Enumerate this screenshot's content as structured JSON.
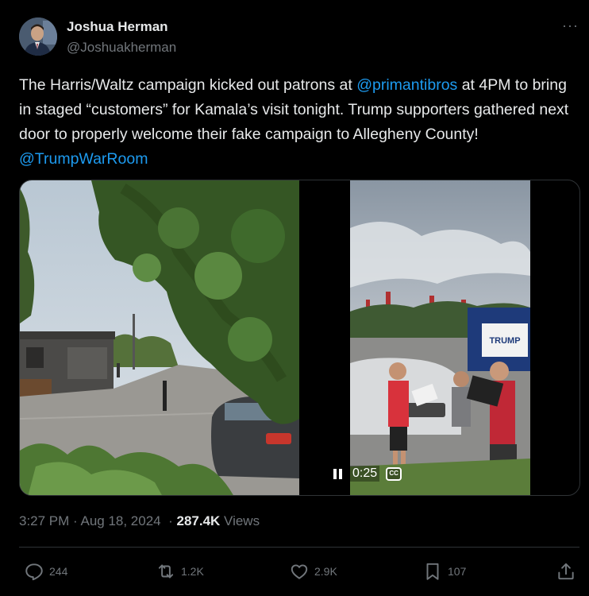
{
  "author": {
    "name": "Joshua Herman",
    "handle": "@Joshuakherman"
  },
  "more_menu": "···",
  "tweet": {
    "text_part1": "The Harris/Waltz campaign kicked out patrons at ",
    "mention1": "@primantibros",
    "text_part2": "  at 4PM to bring in staged “customers” for Kamala’s visit tonight. Trump supporters gathered next door to properly welcome their fake campaign to Allegheny County! ",
    "mention2": "@TrumpWarRoom"
  },
  "media": {
    "video_time": "0:25",
    "cc_label": "CC",
    "sign_text": "TRUMP"
  },
  "meta": {
    "time": "3:27 PM",
    "separator": " · ",
    "date": "Aug 18, 2024",
    "views_count": "287.4K",
    "views_label": " Views"
  },
  "actions": {
    "replies": "244",
    "reposts": "1.2K",
    "likes": "2.9K",
    "bookmarks": "107"
  },
  "colors": {
    "background": "#000000",
    "text": "#e7e9ea",
    "secondary": "#71767b",
    "link": "#1d9bf0",
    "border": "#2f3336"
  }
}
